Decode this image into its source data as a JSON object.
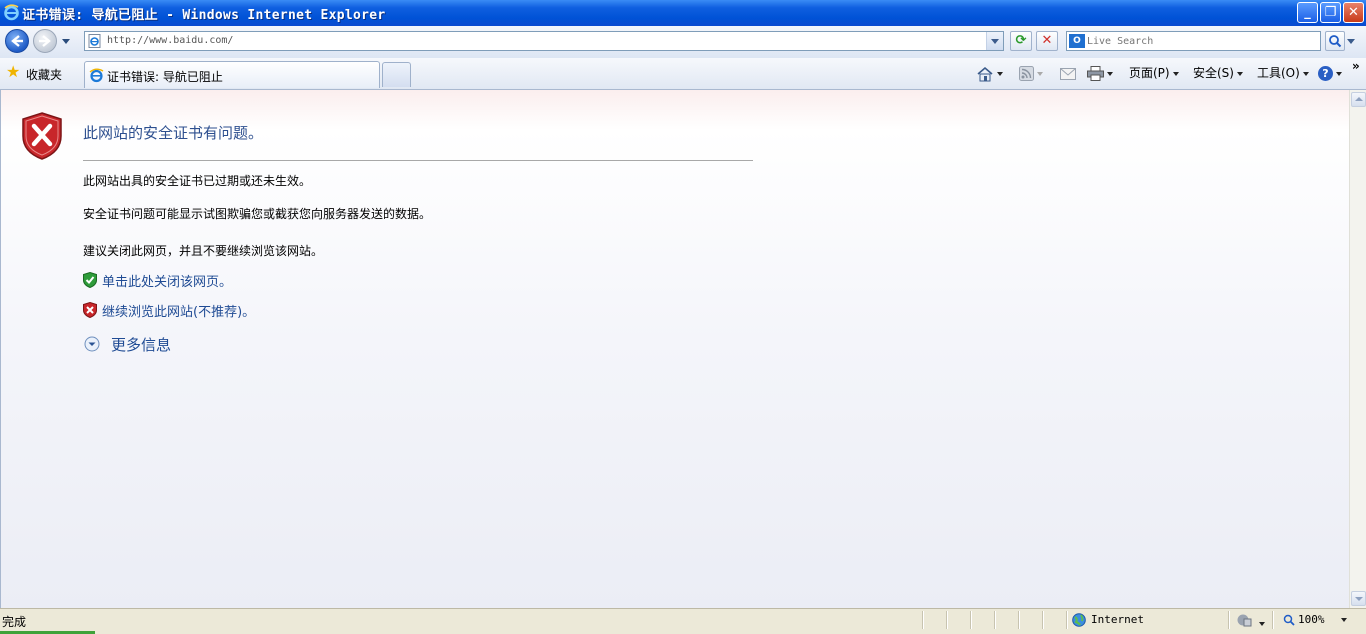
{
  "window": {
    "title": "证书错误: 导航已阻止 - Windows Internet Explorer",
    "minimize_label": "_",
    "restore_label": "❐",
    "close_label": "✕"
  },
  "nav": {
    "address_url": "http://www.baidu.com/",
    "search_placeholder": "Live Search",
    "refresh_label": "⟳",
    "stop_label": "✕"
  },
  "toolbar": {
    "favorites_label": "收藏夹",
    "tab_title": "证书错误: 导航已阻止",
    "page_label": "页面(P)",
    "safety_label": "安全(S)",
    "tools_label": "工具(O)",
    "help_label": "?",
    "chevron_label": "»"
  },
  "content": {
    "heading": "此网站的安全证书有问题。",
    "line1": "此网站出具的安全证书已过期或还未生效。",
    "line2": "安全证书问题可能显示试图欺骗您或截获您向服务器发送的数据。",
    "line3": "建议关闭此网页，并且不要继续浏览该网站。",
    "close_link": "单击此处关闭该网页。",
    "continue_link": "继续浏览此网站(不推荐)。",
    "more_info": "更多信息"
  },
  "status": {
    "text": "完成",
    "zone": "Internet",
    "zoom": "100%"
  },
  "colors": {
    "title_bar": "#0052d6",
    "link": "#1f4b94",
    "heading": "#2d4f8f",
    "error_red": "#c8262a",
    "safe_green": "#2e9c3a"
  }
}
